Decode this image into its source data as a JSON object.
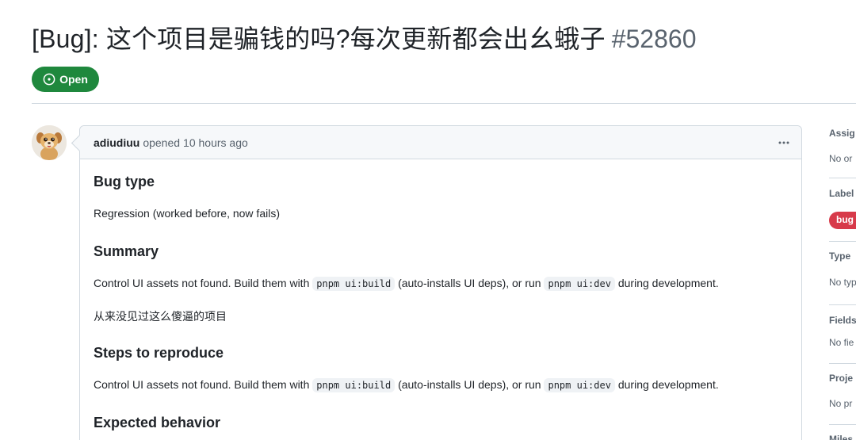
{
  "issue": {
    "title": "[Bug]: 这个项目是骗钱的吗?每次更新都会出幺蛾子",
    "number": "#52860",
    "state": "Open"
  },
  "comment": {
    "author": "adiudiuu",
    "opened": "opened",
    "time": "10 hours ago",
    "menu_icon": "kebab-horizontal-icon",
    "sections": [
      {
        "heading": "Bug type",
        "text": "Regression (worked before, now fails)"
      },
      {
        "heading": "Summary",
        "text_a": "Control UI assets not found. Build them with",
        "code_a": "pnpm ui:build",
        "text_b": "(auto-installs UI deps), or run",
        "code_b": "pnpm ui:dev",
        "text_c": "during development.",
        "extra": "从来没见过这么傻逼的项目"
      },
      {
        "heading": "Steps to reproduce",
        "text_a": "Control UI assets not found. Build them with",
        "code_a": "pnpm ui:build",
        "text_b": "(auto-installs UI deps), or run",
        "code_b": "pnpm ui:dev",
        "text_c": "during development."
      },
      {
        "heading": "Expected behavior"
      }
    ]
  },
  "sidebar": {
    "assignees": {
      "label": "Assig",
      "value": "No or"
    },
    "labels": {
      "label": "Label",
      "value": "bug"
    },
    "type": {
      "label": "Type",
      "value": "No typ"
    },
    "fields": {
      "label": "Fields",
      "value": "No fie"
    },
    "projects": {
      "label": "Proje",
      "value": "No pr"
    },
    "milestone": {
      "label": "Miles"
    }
  },
  "colors": {
    "open_green": "#1f883d",
    "bug_red": "#d73a4a",
    "border": "#d1d9e0",
    "muted_text": "#59636e"
  }
}
